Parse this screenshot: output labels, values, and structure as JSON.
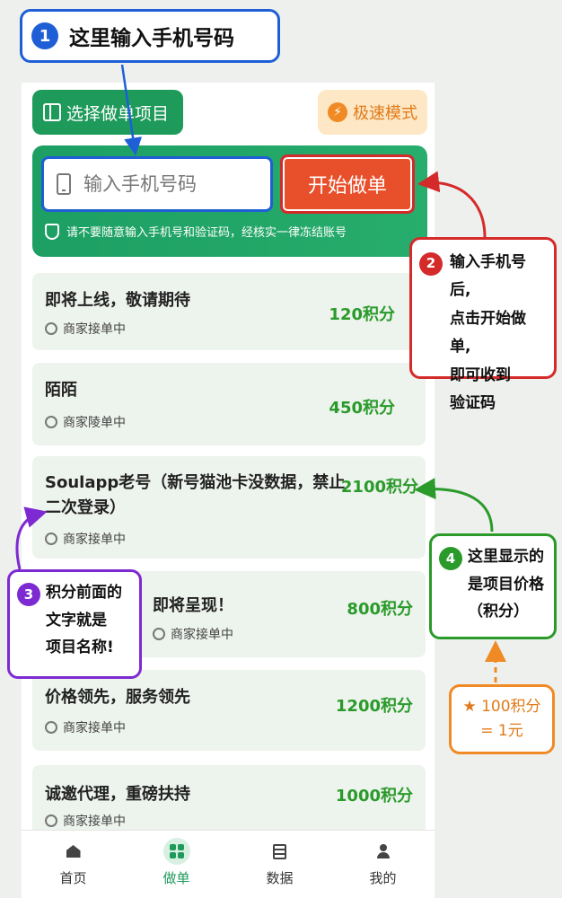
{
  "toolbar": {
    "select_label": "选择做单项目",
    "fast_label": "极速模式",
    "fast_glyph": "⚡"
  },
  "panel": {
    "phone_placeholder": "输入手机号码",
    "start_label": "开始做单",
    "warning": "请不要随意输入手机号和验证码，经核实一律冻结账号"
  },
  "items": [
    {
      "name": "即将上线，敬请期待",
      "status": "商家接单中",
      "points": "120积分"
    },
    {
      "name": "陌陌",
      "status": "商家陵单中",
      "points": "450积分"
    },
    {
      "name_line1": "Soulapp老号（新号猫池卡没数据，禁止",
      "name_line2": "二次登录）",
      "status": "商家接单中",
      "points": "2100积分"
    },
    {
      "name": "即将呈现！",
      "status": "商家接单中",
      "points": "800积分"
    },
    {
      "name": "价格领先，服务领先",
      "status": "商家接单中",
      "points": "1200积分"
    },
    {
      "name": "诚邀代理，重磅扶持",
      "status": "商家接单中",
      "points": "1000积分"
    }
  ],
  "nav": [
    {
      "label": "首页"
    },
    {
      "label": "做单"
    },
    {
      "label": "数据"
    },
    {
      "label": "我的"
    }
  ],
  "annotations": {
    "a1": {
      "num": "1",
      "text": "这里输入手机号码"
    },
    "a2": {
      "num": "2",
      "line1": "输入手机号后,",
      "line2": "点击开始做单,",
      "line3": "即可收到",
      "line4": "验证码"
    },
    "a3": {
      "num": "3",
      "line1": "积分前面的",
      "line2": "文字就是",
      "line3": "项目名称!"
    },
    "a4": {
      "num": "4",
      "line1": "这里显示的",
      "line2": "是项目价格",
      "line3": "（积分）"
    },
    "a5": {
      "star": "★",
      "line1": "100积分",
      "line2": "= 1元"
    }
  },
  "colors": {
    "green": "#1e9a5a",
    "blue": "#1f5fd6",
    "red": "#d42a2a",
    "purple": "#7e2ad2",
    "orange": "#f08a24"
  }
}
